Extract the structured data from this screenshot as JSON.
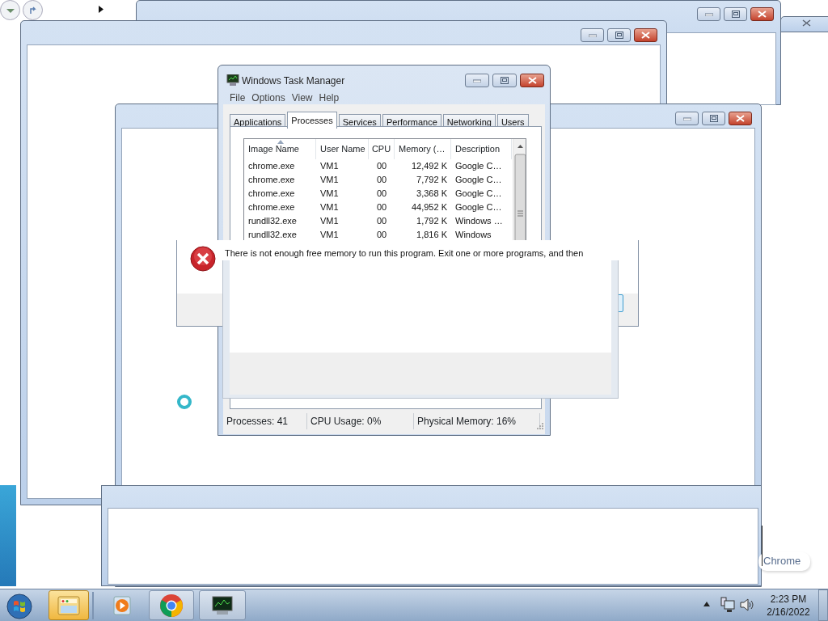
{
  "task_manager": {
    "title": "Windows Task Manager",
    "menu": [
      "File",
      "Options",
      "View",
      "Help"
    ],
    "tabs": [
      {
        "label": "Applications",
        "selected": false
      },
      {
        "label": "Processes",
        "selected": true
      },
      {
        "label": "Services",
        "selected": false
      },
      {
        "label": "Performance",
        "selected": false
      },
      {
        "label": "Networking",
        "selected": false
      },
      {
        "label": "Users",
        "selected": false
      }
    ],
    "columns": [
      "Image Name",
      "User Name",
      "CPU",
      "Memory (…",
      "Description"
    ],
    "rows": [
      [
        "chrome.exe",
        "VM1",
        "00",
        "12,492 K",
        "Google C…"
      ],
      [
        "chrome.exe",
        "VM1",
        "00",
        "7,792 K",
        "Google C…"
      ],
      [
        "chrome.exe",
        "VM1",
        "00",
        "3,368 K",
        "Google C…"
      ],
      [
        "chrome.exe",
        "VM1",
        "00",
        "44,952 K",
        "Google C…"
      ],
      [
        "rundll32.exe",
        "VM1",
        "00",
        "1,792 K",
        "Windows …"
      ],
      [
        "rundll32.exe",
        "VM1",
        "00",
        "1,816 K",
        "Windows"
      ]
    ],
    "status_bar": [
      "Processes: 41",
      "CPU Usage: 0%",
      "Physical Memory: 16%"
    ]
  },
  "error_dialog": {
    "message": "There is not enough free memory to run this program. Exit one or more programs, and then"
  },
  "chrome_label": "Chrome",
  "taskbar": {
    "items": [
      {
        "kind": "start",
        "selected": false,
        "running": false
      },
      {
        "kind": "explorer",
        "selected": true,
        "running": true
      },
      {
        "kind": "media_player",
        "selected": false,
        "running": false
      },
      {
        "kind": "chrome",
        "selected": false,
        "running": true
      },
      {
        "kind": "task_manager",
        "selected": false,
        "running": true
      }
    ],
    "clock": {
      "time": "2:23 PM",
      "date": "2/16/2022"
    }
  }
}
